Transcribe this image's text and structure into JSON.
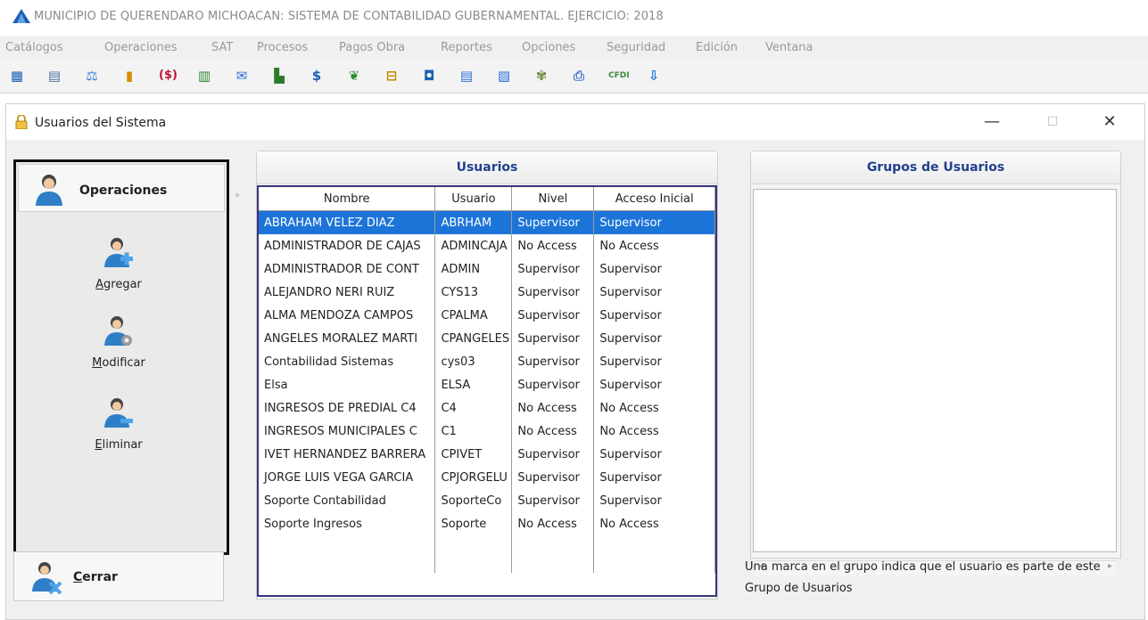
{
  "app": {
    "title": "MUNICIPIO DE QUERENDARO MICHOACAN: SISTEMA DE CONTABILIDAD GUBERNAMENTAL. EJERCICIO: 2018"
  },
  "menu": [
    "Catálogos",
    "Operaciones",
    "SAT",
    "Procesos",
    "Pagos Obra",
    "Reportes",
    "Opciones",
    "Seguridad",
    "Edición",
    "Ventana"
  ],
  "toolbar_icons": [
    "grid-icon",
    "calendar-icon",
    "scales-icon",
    "bar-chart-icon",
    "money-bracket-icon",
    "columns-icon",
    "mail-icon",
    "building-icon",
    "dollar-icon",
    "leaf-icon",
    "basket-icon",
    "book-icon",
    "document-icon",
    "page-icon",
    "palette-icon",
    "printer-icon",
    "cfdi-icon",
    "export-icon"
  ],
  "window": {
    "title": "Usuarios del Sistema",
    "minimize": "—",
    "maximize": "☐",
    "close": "✕"
  },
  "operations": {
    "header": "Operaciones",
    "agregar_first": "A",
    "agregar_rest": "gregar",
    "modificar_first": "M",
    "modificar_rest": "odificar",
    "eliminar_first": "E",
    "eliminar_rest": "liminar",
    "cerrar_first": "C",
    "cerrar_rest": "errar"
  },
  "usuarios": {
    "title": "Usuarios",
    "columns": [
      "Nombre",
      "Usuario",
      "Nivel",
      "Acceso Inicial"
    ],
    "rows": [
      [
        "ABRAHAM VELEZ DIAZ",
        "ABRHAM",
        "Supervisor",
        "Supervisor"
      ],
      [
        "ADMINISTRADOR DE CAJAS",
        "ADMINCAJA",
        "No Access",
        "No Access"
      ],
      [
        "ADMINISTRADOR DE CONT",
        "ADMIN",
        "Supervisor",
        "Supervisor"
      ],
      [
        "ALEJANDRO NERI RUIZ",
        "CYS13",
        "Supervisor",
        "Supervisor"
      ],
      [
        "ALMA MENDOZA CAMPOS",
        "CPALMA",
        "Supervisor",
        "Supervisor"
      ],
      [
        "ANGELES MORALEZ MARTI",
        "CPANGELES",
        "Supervisor",
        "Supervisor"
      ],
      [
        "Contabilidad Sistemas",
        "cys03",
        "Supervisor",
        "Supervisor"
      ],
      [
        "Elsa",
        "ELSA",
        "Supervisor",
        "Supervisor"
      ],
      [
        "INGRESOS DE PREDIAL C4",
        "C4",
        "No Access",
        "No Access"
      ],
      [
        "INGRESOS MUNICIPALES C",
        "C1",
        "No Access",
        "No Access"
      ],
      [
        "IVET HERNANDEZ BARRERA",
        "CPIVET",
        "Supervisor",
        "Supervisor"
      ],
      [
        "JORGE LUIS VEGA GARCIA",
        "CPJORGELU",
        "Supervisor",
        "Supervisor"
      ],
      [
        "Soporte Contabilidad",
        "SoporteCo",
        "Supervisor",
        "Supervisor"
      ],
      [
        "Soporte Ingresos",
        "Soporte",
        "No Access",
        "No Access"
      ]
    ]
  },
  "grupos": {
    "title": "Grupos de Usuarios",
    "note": "Una marca en el grupo indica que el usuario es parte de este Grupo de Usuarios"
  },
  "colors": {
    "selection": "#1c74d8",
    "header_text": "#23408e",
    "menu_text": "#9a9a9a"
  }
}
